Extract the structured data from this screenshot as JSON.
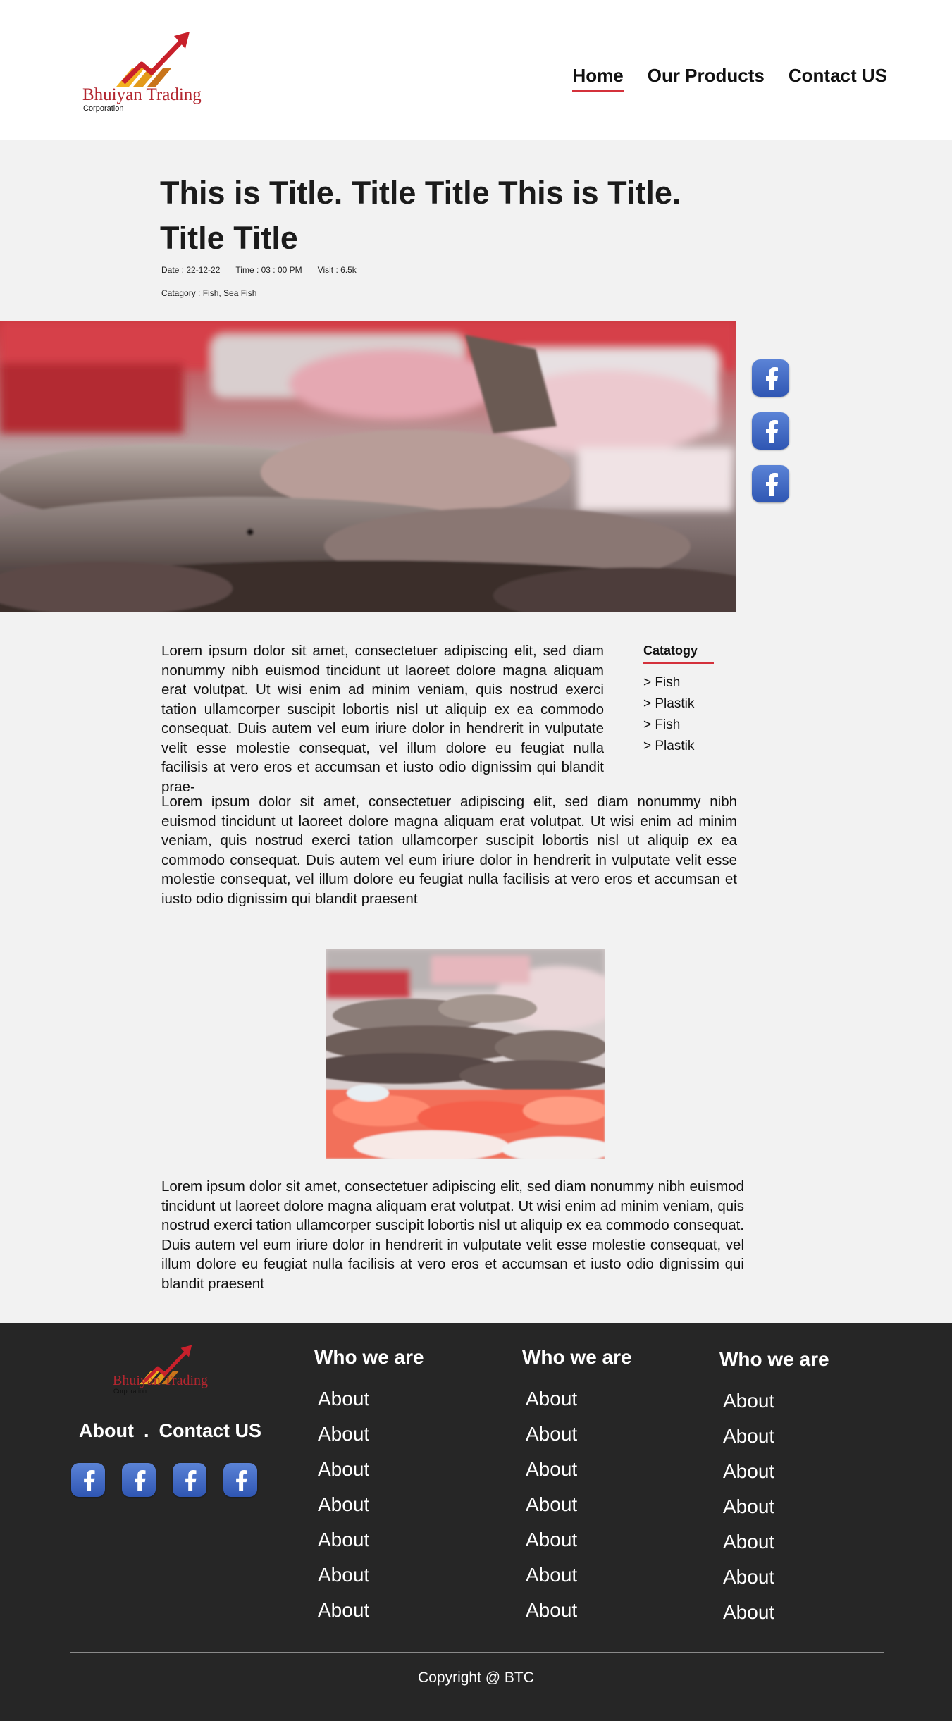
{
  "brand": {
    "name": "Bhuiyan Trading",
    "sub": "Corporation",
    "colors": {
      "accent": "#d4313b",
      "logo_gold": "#f2b020",
      "logo_red": "#c8202b",
      "footer_bg": "#262626",
      "facebook": "#3b63c4"
    }
  },
  "nav": {
    "items": [
      {
        "label": "Home",
        "active": true
      },
      {
        "label": "Our Products"
      },
      {
        "label": "Contact US"
      }
    ]
  },
  "article": {
    "title": "This is Title. Title Title This is Title. Title Title",
    "date": "Date : 22-12-22",
    "time": "Time : 03 : 00 PM",
    "visit": "Visit : 6.5k",
    "category": "Catagory : Fish, Sea Fish",
    "paragraphs": [
      "Lorem ipsum dolor sit amet, consectetuer adipiscing elit, sed diam nonummy nibh euismod tincidunt ut laoreet dolore magna aliquam erat volutpat. Ut wisi enim ad minim veniam, quis nostrud exerci tation ullamcorper suscipit lobortis nisl ut aliquip ex ea commodo consequat. Duis autem vel eum iriure dolor in hendrerit in vulputate velit esse molestie consequat, vel illum dolore eu feugiat nulla facilisis at vero eros et accumsan et iusto odio dignissim qui blandit prae-",
      "Lorem ipsum dolor sit amet, consectetuer adipiscing elit, sed diam nonummy nibh euismod tincidunt ut laoreet dolore magna aliquam erat volutpat. Ut wisi enim ad minim veniam, quis nostrud exerci tation ullamcorper suscipit lobortis nisl ut aliquip ex ea commodo consequat. Duis autem vel eum iriure dolor in hendrerit in vulputate velit esse molestie consequat, vel illum dolore eu feugiat nulla facilisis at vero eros et accumsan et iusto odio dignissim qui blandit praesent",
      "Lorem ipsum dolor sit amet, consectetuer adipiscing elit, sed diam nonummy nibh euismod tincidunt ut laoreet dolore magna aliquam erat volutpat. Ut wisi enim ad minim veniam, quis nostrud exerci tation ullamcorper suscipit lobortis nisl ut aliquip ex ea commodo consequat. Duis autem vel eum iriure dolor in hendrerit in vulputate velit esse molestie consequat, vel illum dolore eu feugiat nulla facilisis at vero eros et accumsan et iusto odio dignissim qui blandit praesent"
    ]
  },
  "share_icons": [
    "facebook-icon",
    "facebook-icon",
    "facebook-icon"
  ],
  "sidebar": {
    "title": "Catatogy",
    "items": [
      "> Fish",
      "> Plastik",
      "> Fish",
      "> Plastik"
    ]
  },
  "footer": {
    "links": {
      "about": "About",
      "dot": ".",
      "contact": "Contact US"
    },
    "social_icons": [
      "facebook-icon",
      "facebook-icon",
      "facebook-icon",
      "facebook-icon"
    ],
    "columns": [
      {
        "title": "Who we are",
        "items": [
          "About",
          "About",
          "About",
          "About",
          "About",
          "About",
          "About"
        ]
      },
      {
        "title": "Who we are",
        "items": [
          "About",
          "About",
          "About",
          "About",
          "About",
          "About",
          "About"
        ]
      },
      {
        "title": "Who we are",
        "items": [
          "About",
          "About",
          "About",
          "About",
          "About",
          "About",
          "About"
        ]
      }
    ],
    "copyright": "Copyright @ BTC"
  }
}
